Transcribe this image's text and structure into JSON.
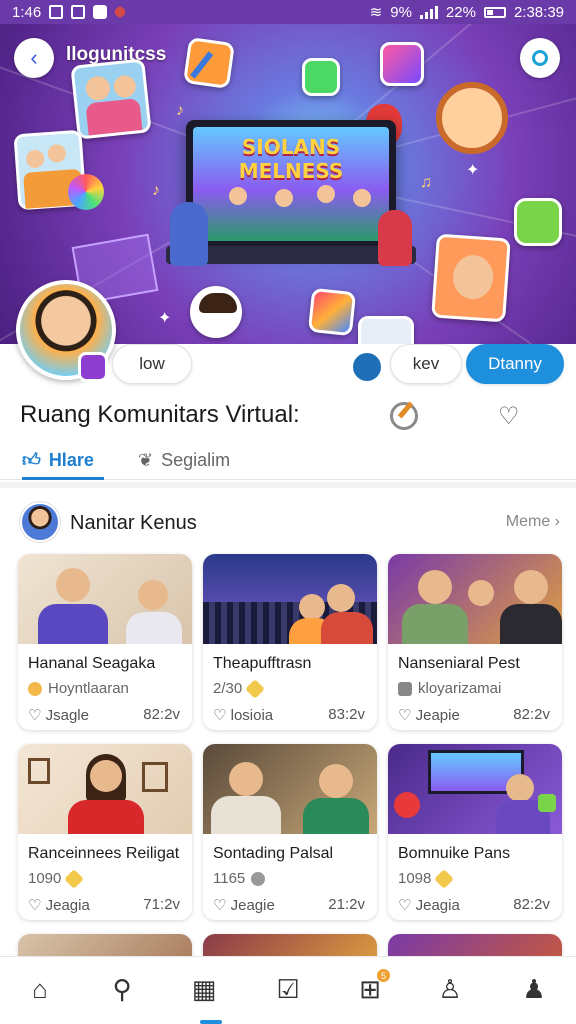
{
  "status_bar": {
    "time": "1:46",
    "battery": "22%",
    "signal_text": "9%",
    "clock_right": "2:38:39"
  },
  "hero": {
    "title": "llogunitcss",
    "screen_title": "SIOLANS MELNESS"
  },
  "actions": {
    "pill_1": "low",
    "pill_2": "kev",
    "primary": "Dtanny"
  },
  "page_title": "Ruang Komunitars Virtual:",
  "tabs": [
    {
      "label": "Hlare"
    },
    {
      "label": "Segialim"
    }
  ],
  "section": {
    "title": "Nanitar Kenus",
    "more": "Meme"
  },
  "cards": [
    {
      "title": "Hananal Seagaka",
      "sub": "Hoyntlaaran",
      "foot_left": "Jsagle",
      "foot_right": "82:2v"
    },
    {
      "title": "Theapufftrasn",
      "sub": "2/30",
      "foot_left": "losioia",
      "foot_right": "83:2v"
    },
    {
      "title": "Nanseniaral Pest",
      "sub": "kloyarizamai",
      "foot_left": "Jeapie",
      "foot_right": "82:2v"
    },
    {
      "title": "Ranceinnees Reiligat",
      "sub": "1090",
      "foot_left": "Jeagia",
      "foot_right": "71:2v"
    },
    {
      "title": "Sontading Palsal",
      "sub": "1165",
      "foot_left": "Jeagie",
      "foot_right": "21:2v"
    },
    {
      "title": "Bomnuike Pans",
      "sub": "1098",
      "foot_left": "Jeagia",
      "foot_right": "82:2v"
    }
  ],
  "colors": {
    "accent": "#1e8fdc",
    "hero_purple": "#7a3fb8",
    "status_bar": "#6a3aa8"
  },
  "nav": {
    "badge": "5"
  }
}
